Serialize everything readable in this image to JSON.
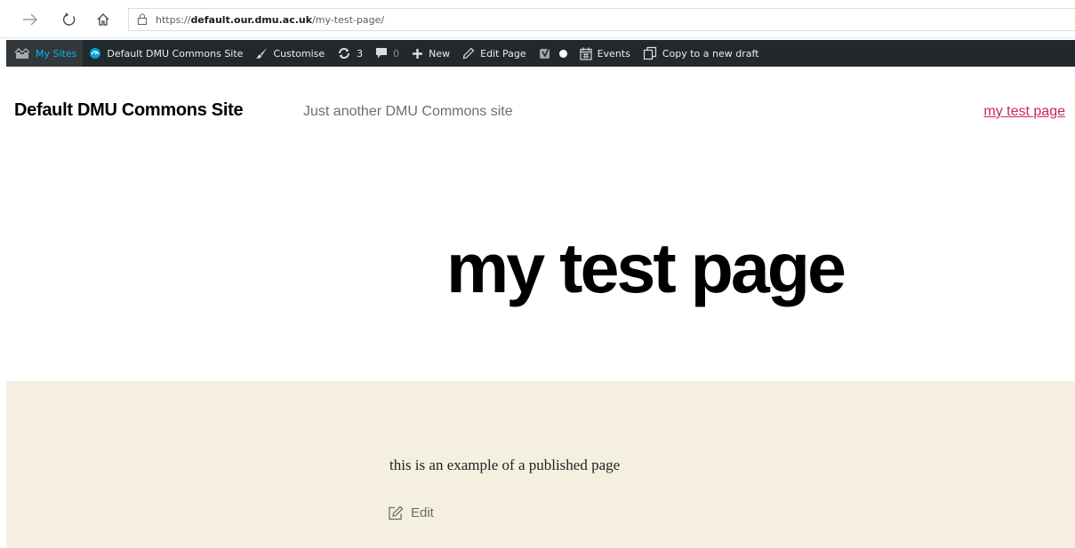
{
  "browser": {
    "url_scheme": "https://",
    "url_host": "default.our.dmu.ac.uk",
    "url_path": "/my-test-page/",
    "icons": [
      "arrow-forward-icon",
      "refresh-icon",
      "home-icon",
      "lock-icon"
    ]
  },
  "admin_bar": {
    "my_sites": "My Sites",
    "site_name": "Default DMU Commons Site",
    "customise": "Customise",
    "updates_count": "3",
    "comments_count": "0",
    "new": "New",
    "edit_page": "Edit Page",
    "events": "Events",
    "copy_draft": "Copy to a new draft"
  },
  "site": {
    "title": "Default DMU Commons Site",
    "description": "Just another DMU Commons site",
    "nav_link": "my test page"
  },
  "page": {
    "title": "my test page",
    "content": "this is an example of a published page",
    "edit_label": "Edit"
  },
  "colors": {
    "admin_bar_bg": "#23282d",
    "my_sites_accent": "#00b9eb",
    "link_accent": "#cd2653",
    "content_bg": "#f5efe0"
  }
}
